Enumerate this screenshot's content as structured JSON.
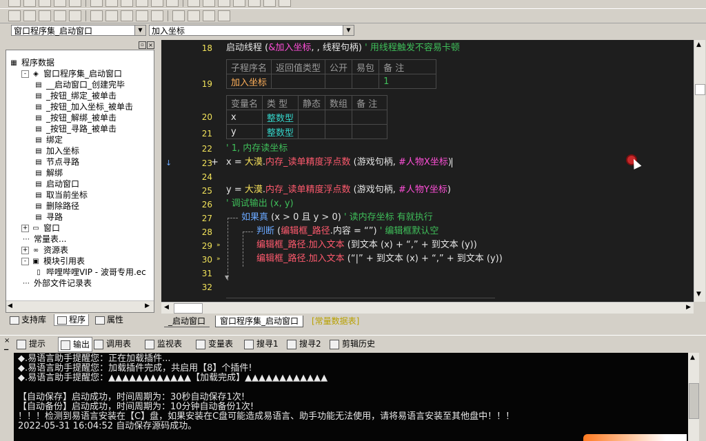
{
  "toolbar": {
    "row1_buttons": 18,
    "row2_buttons": 14
  },
  "selectors": {
    "left_value": "窗口程序集_启动窗口",
    "right_value": "加入坐标"
  },
  "tree": {
    "items": [
      {
        "label": "程序数据",
        "indent": 0,
        "pm": "",
        "icon": "program-data-icon"
      },
      {
        "label": "窗口程序集_启动窗口",
        "indent": 1,
        "pm": "-",
        "icon": "assembly-icon"
      },
      {
        "label": "__启动窗口_创建完毕",
        "indent": 2,
        "pm": "",
        "icon": "subroutine-icon"
      },
      {
        "label": "_按钮_绑定_被单击",
        "indent": 2,
        "pm": "",
        "icon": "subroutine-icon"
      },
      {
        "label": "_按钮_加入坐标_被单击",
        "indent": 2,
        "pm": "",
        "icon": "subroutine-icon"
      },
      {
        "label": "_按钮_解绑_被单击",
        "indent": 2,
        "pm": "",
        "icon": "subroutine-icon"
      },
      {
        "label": "_按钮_寻路_被单击",
        "indent": 2,
        "pm": "",
        "icon": "subroutine-icon"
      },
      {
        "label": "绑定",
        "indent": 2,
        "pm": "",
        "icon": "subroutine-icon"
      },
      {
        "label": "加入坐标",
        "indent": 2,
        "pm": "",
        "icon": "subroutine-icon"
      },
      {
        "label": "节点寻路",
        "indent": 2,
        "pm": "",
        "icon": "subroutine-icon"
      },
      {
        "label": "解绑",
        "indent": 2,
        "pm": "",
        "icon": "subroutine-icon"
      },
      {
        "label": "启动窗口",
        "indent": 2,
        "pm": "",
        "icon": "subroutine-icon"
      },
      {
        "label": "取当前坐标",
        "indent": 2,
        "pm": "",
        "icon": "subroutine-icon"
      },
      {
        "label": "删除路径",
        "indent": 2,
        "pm": "",
        "icon": "subroutine-icon"
      },
      {
        "label": "寻路",
        "indent": 2,
        "pm": "",
        "icon": "subroutine-icon"
      },
      {
        "label": "窗口",
        "indent": 1,
        "pm": "+",
        "icon": "window-icon"
      },
      {
        "label": "常量表...",
        "indent": 1,
        "pm": "",
        "icon": "constant-icon"
      },
      {
        "label": "资源表",
        "indent": 1,
        "pm": "+",
        "icon": "resource-icon"
      },
      {
        "label": "模块引用表",
        "indent": 1,
        "pm": "-",
        "icon": "module-icon"
      },
      {
        "label": "哔哩哔哩VIP - 波哥专用.ec",
        "indent": 2,
        "pm": "",
        "icon": "module-file-icon"
      },
      {
        "label": "外部文件记录表",
        "indent": 1,
        "pm": "",
        "icon": "file-record-icon"
      }
    ]
  },
  "left_tabs": [
    {
      "label": "支持库",
      "icon": "library-icon"
    },
    {
      "label": "程序",
      "icon": "program-icon"
    },
    {
      "label": "属性",
      "icon": "property-icon"
    }
  ],
  "editor": {
    "line18": {
      "num": "18",
      "kw": "启动线程",
      "rest1": " (",
      "arg1": "&加入坐标",
      "rest2": ", , 线程句柄) ",
      "cmt": "' 用线程触发不容易卡顿"
    },
    "sub_table": {
      "headers": [
        "子程序名",
        "返回值类型",
        "公开",
        "易包",
        "备 注"
      ],
      "row": [
        "加入坐标",
        "",
        "",
        "",
        "1"
      ],
      "num": "19"
    },
    "var_table": {
      "headers": [
        "变量名",
        "类 型",
        "静态",
        "数组",
        "备 注"
      ],
      "rows": [
        {
          "num": "20",
          "name": "x",
          "type": "整数型"
        },
        {
          "num": "21",
          "name": "y",
          "type": "整数型"
        }
      ]
    },
    "line22": {
      "num": "22",
      "cmt": "' 1, 内存读坐标"
    },
    "line23": {
      "num": "23",
      "plus": "+",
      "var": "x",
      "eq": " = ",
      "obj": "大漠",
      "dot": ".",
      "fn": "内存_读单精度浮点数",
      "open": " (游戏句柄, ",
      "const": "#人物X坐标",
      "close": ")"
    },
    "line24": {
      "num": "24"
    },
    "line25": {
      "num": "25",
      "var": "y",
      "eq": " = ",
      "obj": "大漠",
      "dot": ".",
      "fn": "内存_读单精度浮点数",
      "open": " (游戏句柄, ",
      "const": "#人物Y坐标",
      "close": ")"
    },
    "line26": {
      "num": "26",
      "cmt": "' 调试输出 (x, y)"
    },
    "line27": {
      "num": "27",
      "kw": "如果真",
      "body": " (x > 0 且 y > 0) ",
      "cmt": "' 读内存坐标 有就执行"
    },
    "line28": {
      "num": "28",
      "kw": "判断",
      "open": " (",
      "obj": "编辑框_路径",
      "body": ".内容 = “”) ",
      "cmt": "' 编辑框默认空"
    },
    "line29": {
      "num": "29",
      "obj": "编辑框_路径",
      "fn": ".加入文本",
      "body": " (到文本 (x) + “,” + 到文本 (y))"
    },
    "line30": {
      "num": "30",
      "obj": "编辑框_路径",
      "fn": ".加入文本",
      "body": " (“|” + 到文本 (x) + “,” + 到文本 (y))"
    },
    "line31": {
      "num": "31"
    },
    "line32": {
      "num": "32"
    }
  },
  "editor_tabs": [
    {
      "label": "_启动窗口"
    },
    {
      "label": "窗口程序集_启动窗口"
    },
    {
      "label": "[常量数据表]"
    }
  ],
  "output_tabs": [
    {
      "label": "提示",
      "icon": "hint-icon"
    },
    {
      "label": "输出",
      "icon": "output-icon"
    },
    {
      "label": "调用表",
      "icon": "call-table-icon"
    },
    {
      "label": "监视表",
      "icon": "watch-icon"
    },
    {
      "label": "变量表",
      "icon": "variable-icon"
    },
    {
      "label": "搜寻1",
      "icon": "search1-icon"
    },
    {
      "label": "搜寻2",
      "icon": "search2-icon"
    },
    {
      "label": "剪辑历史",
      "icon": "clip-history-icon"
    }
  ],
  "output": {
    "lines": [
      "◆.易语言助手提醒您：正在加载插件...",
      "◆.易语言助手提醒您：加载插件完成，共启用【8】个插件!",
      "◆.易语言助手提醒您：▲▲▲▲▲▲▲▲▲▲▲▲【加载完成】▲▲▲▲▲▲▲▲▲▲▲▲",
      "",
      "【自动保存】启动成功，时间周期为：30秒自动保存1次!",
      "【自动备份】启动成功，时间周期为：10分钟自动备份1次!",
      "！！！检测到易语言安装在【C】盘，如果安装在C盘可能造成易语言、助手功能无法使用，请将易语言安装至其他盘中！！！",
      "2022-05-31 16:04:52 自动保存源码成功。"
    ]
  }
}
